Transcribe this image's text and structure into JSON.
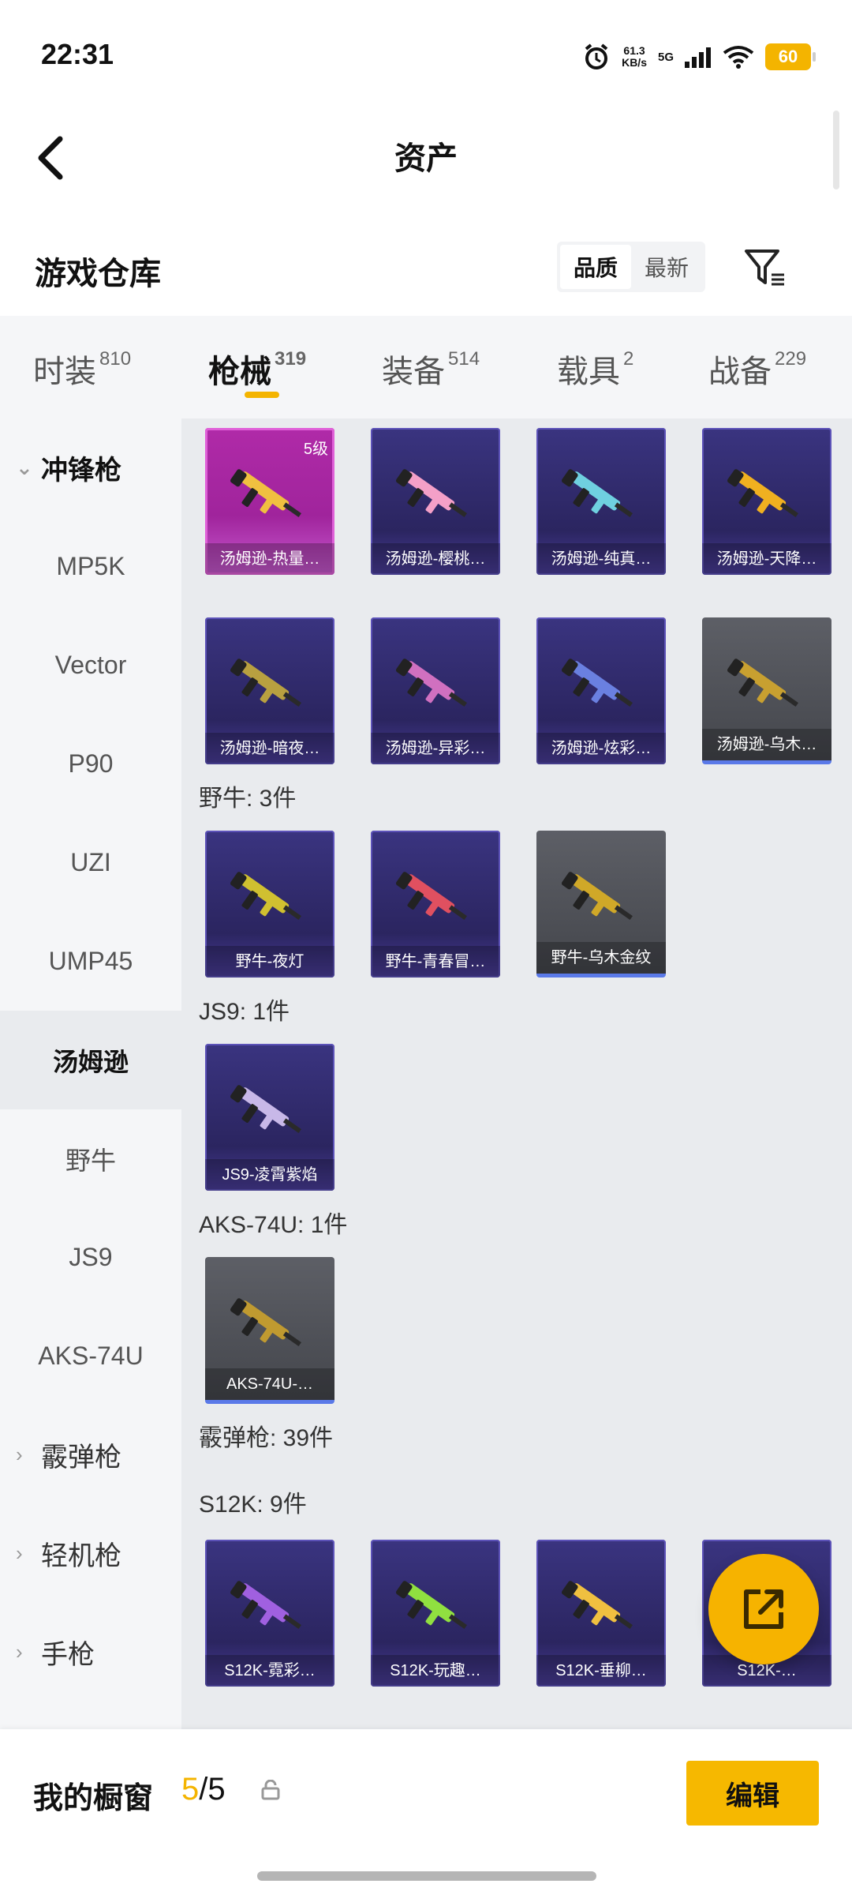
{
  "status_bar": {
    "time": "22:31",
    "net_speed": "61.3",
    "net_unit": "KB/s",
    "net_type": "5G",
    "battery": "60"
  },
  "header": {
    "title": "资产"
  },
  "warehouse": {
    "title": "游戏仓库",
    "sort_options": [
      "品质",
      "最新"
    ],
    "active_sort": "品质"
  },
  "tabs": [
    {
      "label": "时装",
      "count": "810"
    },
    {
      "label": "枪械",
      "count": "319",
      "active": true
    },
    {
      "label": "装备",
      "count": "514"
    },
    {
      "label": "载具",
      "count": "2"
    },
    {
      "label": "战备",
      "count": "229"
    }
  ],
  "leftnav": [
    {
      "label": "冲锋枪",
      "type": "category",
      "open": true
    },
    {
      "label": "MP5K"
    },
    {
      "label": "Vector"
    },
    {
      "label": "P90"
    },
    {
      "label": "UZI"
    },
    {
      "label": "UMP45"
    },
    {
      "label": "汤姆逊",
      "selected": true
    },
    {
      "label": "野牛"
    },
    {
      "label": "JS9"
    },
    {
      "label": "AKS-74U"
    },
    {
      "label": "霰弹枪",
      "type": "category"
    },
    {
      "label": "轻机枪",
      "type": "category"
    },
    {
      "label": "手枪",
      "type": "category"
    }
  ],
  "groups": {
    "bison": "野牛: 3件",
    "js9": "JS9: 1件",
    "aks": "AKS-74U: 1件",
    "shotgun": "霰弹枪: 39件",
    "s12k": "S12K: 9件"
  },
  "items": {
    "thompson": [
      {
        "name": "汤姆逊-热量…",
        "level": "5级",
        "style": "pink",
        "color": "#f0c040"
      },
      {
        "name": "汤姆逊-樱桃…",
        "style": "purple",
        "color": "#f4a0c8"
      },
      {
        "name": "汤姆逊-纯真…",
        "style": "purple",
        "color": "#6fd0e0"
      },
      {
        "name": "汤姆逊-天降…",
        "style": "purple",
        "color": "#f0b020"
      },
      {
        "name": "汤姆逊-暗夜…",
        "style": "purple",
        "color": "#b8a040"
      },
      {
        "name": "汤姆逊-异彩…",
        "style": "purple",
        "color": "#d070c0"
      },
      {
        "name": "汤姆逊-炫彩…",
        "style": "purple",
        "color": "#6a80e0"
      },
      {
        "name": "汤姆逊-乌木…",
        "style": "gray",
        "color": "#c8a030"
      }
    ],
    "bison": [
      {
        "name": "野牛-夜灯",
        "style": "purple",
        "color": "#d0c030"
      },
      {
        "name": "野牛-青春冒…",
        "style": "purple",
        "color": "#e05060"
      },
      {
        "name": "野牛-乌木金纹",
        "style": "gray",
        "color": "#d0a828"
      }
    ],
    "js9": [
      {
        "name": "JS9-凌霄紫焰",
        "style": "purple",
        "color": "#c8b8e8"
      }
    ],
    "aks": [
      {
        "name": "AKS-74U-…",
        "style": "gray",
        "color": "#c09a30"
      }
    ],
    "s12k": [
      {
        "name": "S12K-霓彩…",
        "style": "purple",
        "color": "#a060e0"
      },
      {
        "name": "S12K-玩趣…",
        "style": "purple",
        "color": "#90e040"
      },
      {
        "name": "S12K-垂柳…",
        "style": "purple",
        "color": "#f0c040"
      },
      {
        "name": "S12K-…",
        "style": "purple",
        "color": "#d04040"
      }
    ]
  },
  "bottom": {
    "label": "我的橱窗",
    "count_current": "5",
    "count_sep": "/5",
    "edit_label": "编辑"
  }
}
